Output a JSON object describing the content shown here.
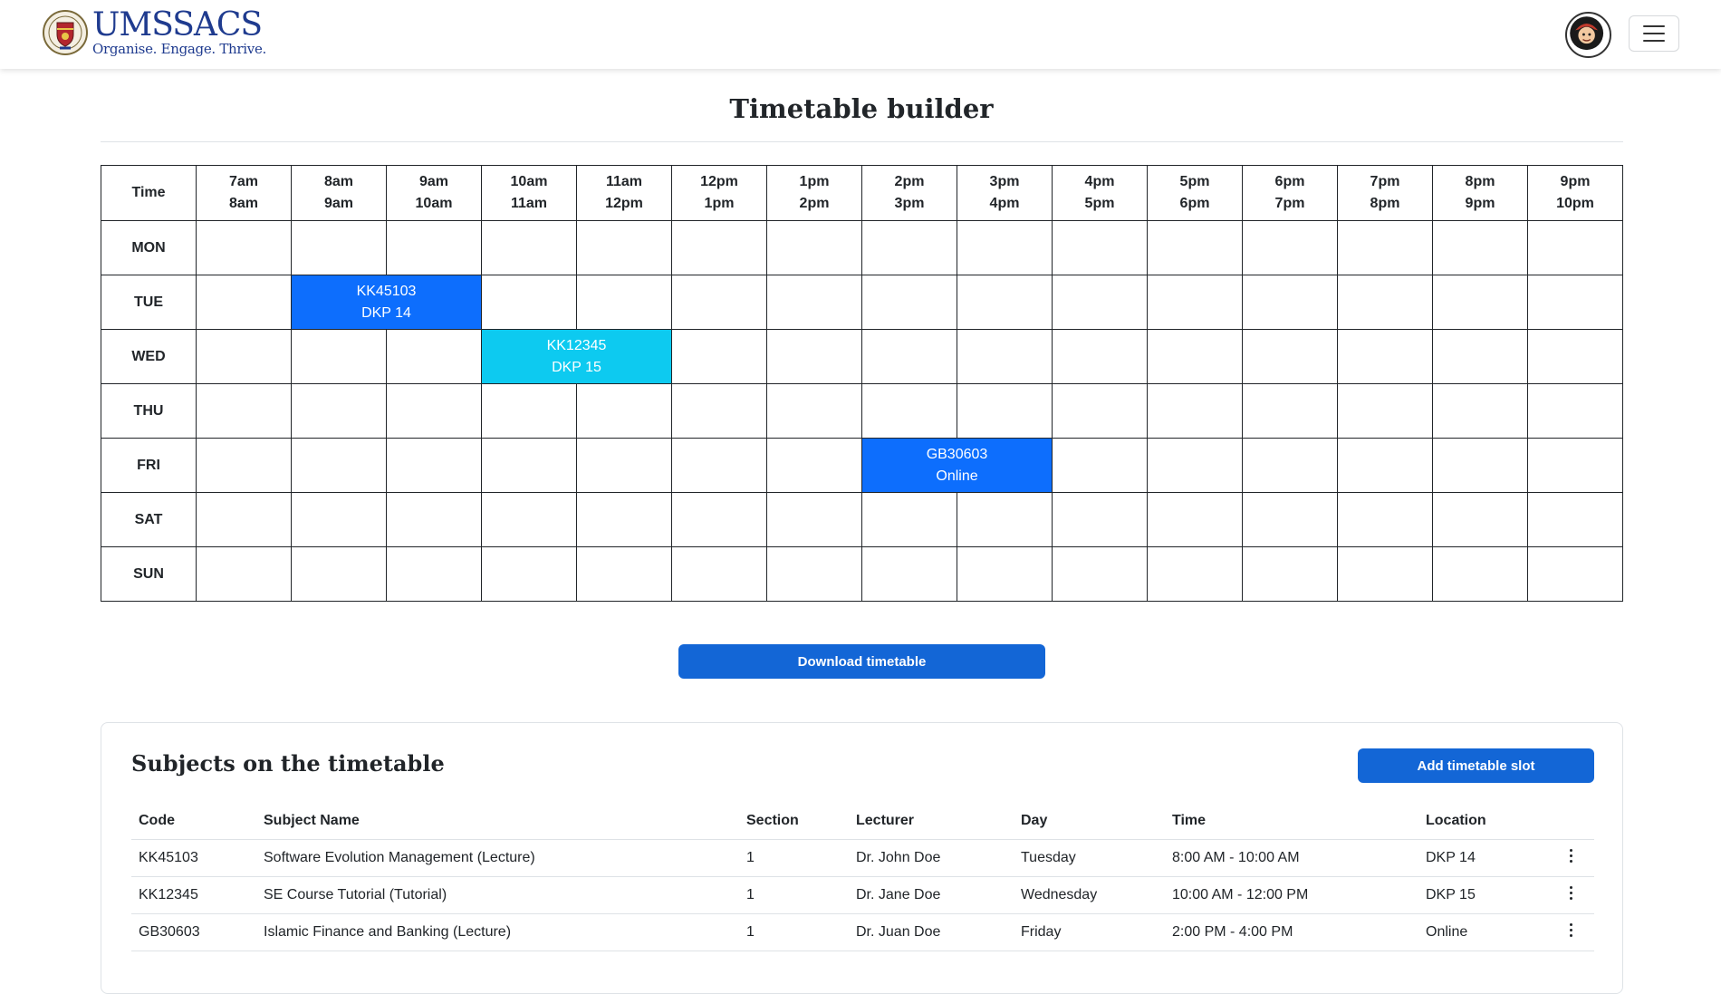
{
  "header": {
    "brand_name": "UMSSACS",
    "brand_tagline": "Organise. Engage. Thrive."
  },
  "page_title": "Timetable builder",
  "timetable": {
    "time_header": "Time",
    "hours": [
      {
        "start": "7am",
        "end": "8am"
      },
      {
        "start": "8am",
        "end": "9am"
      },
      {
        "start": "9am",
        "end": "10am"
      },
      {
        "start": "10am",
        "end": "11am"
      },
      {
        "start": "11am",
        "end": "12pm"
      },
      {
        "start": "12pm",
        "end": "1pm"
      },
      {
        "start": "1pm",
        "end": "2pm"
      },
      {
        "start": "2pm",
        "end": "3pm"
      },
      {
        "start": "3pm",
        "end": "4pm"
      },
      {
        "start": "4pm",
        "end": "5pm"
      },
      {
        "start": "5pm",
        "end": "6pm"
      },
      {
        "start": "6pm",
        "end": "7pm"
      },
      {
        "start": "7pm",
        "end": "8pm"
      },
      {
        "start": "8pm",
        "end": "9pm"
      },
      {
        "start": "9pm",
        "end": "10pm"
      }
    ],
    "days": [
      "MON",
      "TUE",
      "WED",
      "THU",
      "FRI",
      "SAT",
      "SUN"
    ],
    "slots": [
      {
        "day": "TUE",
        "start_hour": "8am",
        "hours": 2,
        "code": "KK45103",
        "location": "DKP 14",
        "color": "#0d6efd"
      },
      {
        "day": "WED",
        "start_hour": "10am",
        "hours": 2,
        "code": "KK12345",
        "location": "DKP 15",
        "color": "#0dcaf0"
      },
      {
        "day": "FRI",
        "start_hour": "2pm",
        "hours": 2,
        "code": "GB30603",
        "location": "Online",
        "color": "#0d6efd"
      }
    ]
  },
  "download_label": "Download timetable",
  "subjects_card": {
    "title": "Subjects on the timetable",
    "add_label": "Add timetable slot",
    "columns": [
      "Code",
      "Subject Name",
      "Section",
      "Lecturer",
      "Day",
      "Time",
      "Location"
    ],
    "rows": [
      {
        "code": "KK45103",
        "name": "Software Evolution Management (Lecture)",
        "section": "1",
        "lecturer": "Dr. John Doe",
        "day": "Tuesday",
        "time": "8:00 AM - 10:00 AM",
        "location": "DKP 14"
      },
      {
        "code": "KK12345",
        "name": "SE Course Tutorial (Tutorial)",
        "section": "1",
        "lecturer": "Dr. Jane Doe",
        "day": "Wednesday",
        "time": "10:00 AM - 12:00 PM",
        "location": "DKP 15"
      },
      {
        "code": "GB30603",
        "name": "Islamic Finance and Banking (Lecture)",
        "section": "1",
        "lecturer": "Dr. Juan Doe",
        "day": "Friday",
        "time": "2:00 PM - 4:00 PM",
        "location": "Online"
      }
    ]
  },
  "colors": {
    "primary": "#1366d6",
    "brand": "#1f3b8f"
  }
}
